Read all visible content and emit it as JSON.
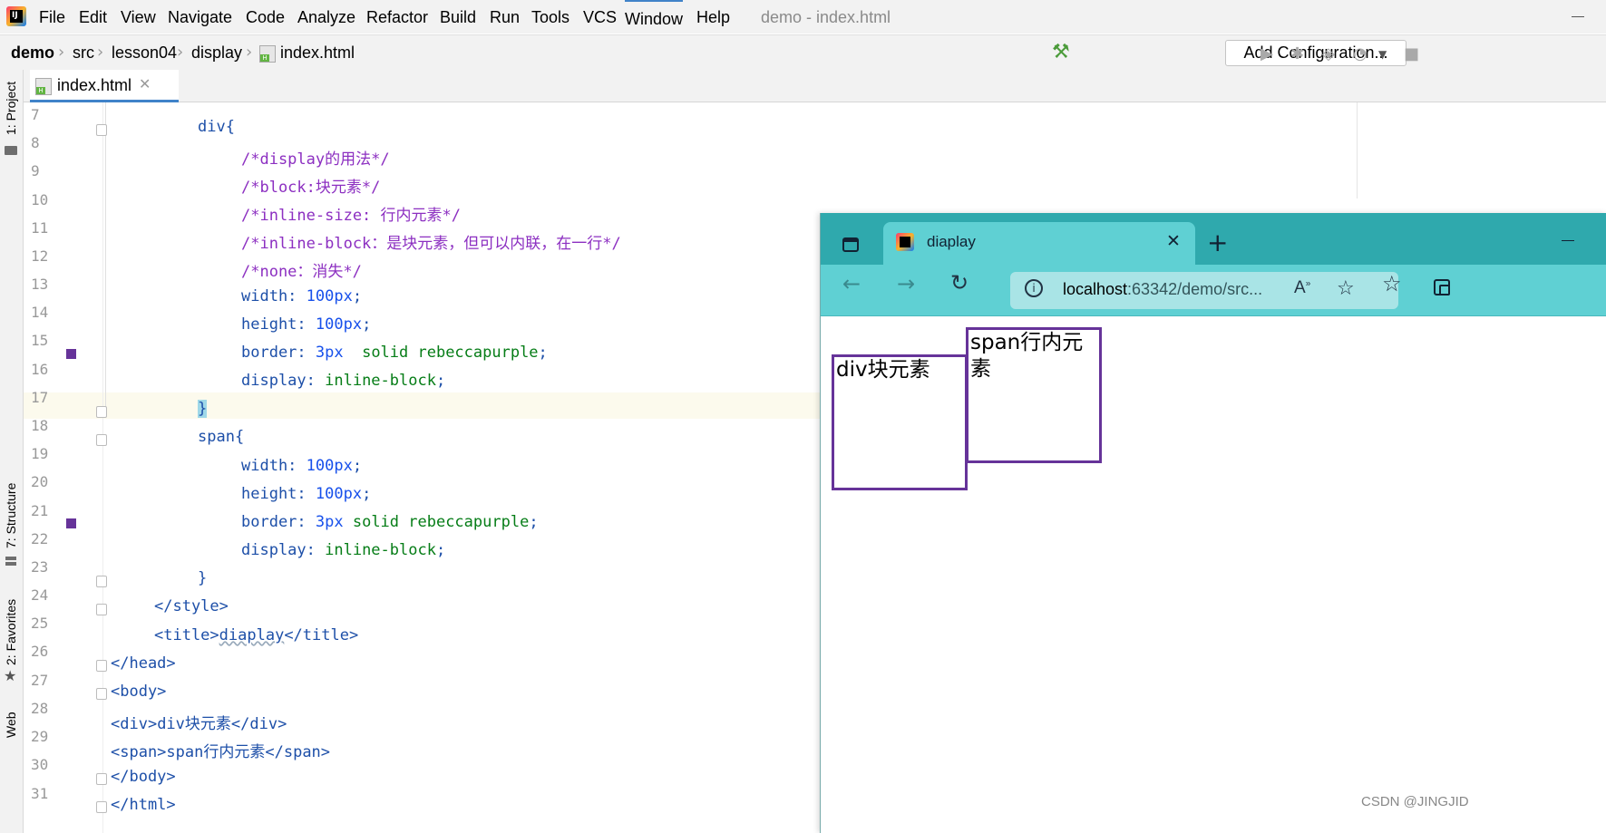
{
  "menubar": {
    "items": [
      "File",
      "Edit",
      "View",
      "Navigate",
      "Code",
      "Analyze",
      "Refactor",
      "Build",
      "Run",
      "Tools",
      "VCS",
      "Window",
      "Help"
    ],
    "window_title": "demo - index.html"
  },
  "breadcrumb": [
    "demo",
    "src",
    "lesson04",
    "display",
    "index.html"
  ],
  "toolbar": {
    "add_configuration": "Add Configuration..."
  },
  "tool_windows": {
    "project": "1: Project",
    "structure": "7: Structure",
    "favorites": "2: Favorites",
    "web": "Web"
  },
  "editor_tab": {
    "label": "index.html"
  },
  "line_numbers": [
    "7",
    "8",
    "9",
    "10",
    "11",
    "12",
    "13",
    "14",
    "15",
    "16",
    "17",
    "18",
    "19",
    "20",
    "21",
    "22",
    "23",
    "24",
    "25",
    "26",
    "27",
    "28",
    "29",
    "30",
    "31"
  ],
  "code": {
    "l7": "div{",
    "l8": "/*display的用法*/",
    "l9": "/*block:块元素*/",
    "l10": "/*inline-size: 行内元素*/",
    "l11": "/*inline-block：是块元素，但可以内联，在一行*/",
    "l12": "/*none：消失*/",
    "l13_prop": "width: ",
    "l13_num": "100px",
    "l13_end": ";",
    "l14_prop": "height: ",
    "l14_num": "100px",
    "l14_end": ";",
    "l15_prop": "border: ",
    "l15_num": "3px",
    "l15_val": "  solid rebeccapurple",
    "l15_end": ";",
    "l16_prop": "display: ",
    "l16_val": "inline-block",
    "l16_end": ";",
    "l17": "}",
    "l18": "span{",
    "l19_prop": "width: ",
    "l19_num": "100px",
    "l19_end": ";",
    "l20_prop": "height: ",
    "l20_num": "100px",
    "l20_end": ";",
    "l21_prop": "border: ",
    "l21_num": "3px",
    "l21_val": " solid rebeccapurple",
    "l21_end": ";",
    "l22_prop": "display: ",
    "l22_val": "inline-block",
    "l22_end": ";",
    "l23": "}",
    "l24": "</style>",
    "l25_open": "<title>",
    "l25_text": "diaplay",
    "l25_close": "</title>",
    "l26": "</head>",
    "l27": "<body>",
    "l28_open": "<div>",
    "l28_text": "div块元素",
    "l28_close": "</div>",
    "l29_open": "<span>",
    "l29_text": "span行内元素",
    "l29_close": "</span>",
    "l30": "</body>",
    "l31": "</html>"
  },
  "colors": {
    "rebeccapurple": "#663399",
    "browser_teal": "#5fd0d3"
  },
  "browser": {
    "tab_title": "diaplay",
    "address_host": "localhost",
    "address_rest": ":63342/demo/src...",
    "div_text": "div块元素",
    "span_text": "span行内元素"
  },
  "watermark": "CSDN @JINGJID"
}
